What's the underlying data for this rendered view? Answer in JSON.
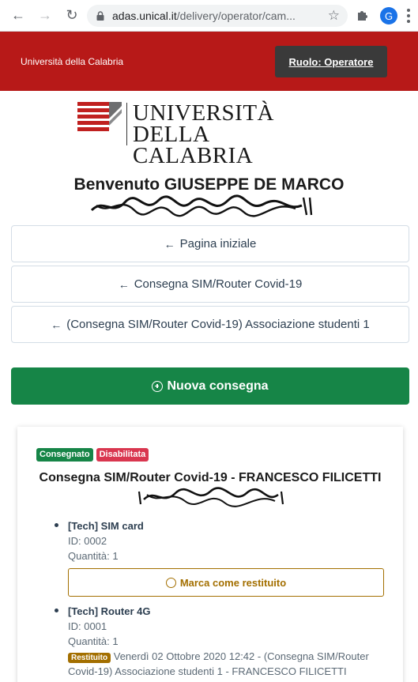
{
  "browser": {
    "url_domain": "adas.unical.it",
    "url_rest": "/delivery/operator/cam...",
    "profile_initial": "G"
  },
  "header": {
    "university_label": "Università della Calabria",
    "role_button": "Ruolo: Operatore"
  },
  "logo": {
    "line1": "UNIVERSITÀ",
    "line2": "DELLA CALABRIA"
  },
  "welcome": {
    "text": "Benvenuto GIUSEPPE DE MARCO"
  },
  "nav": {
    "home": "Pagina iniziale",
    "campaign": "Consegna SIM/Router Covid-19",
    "structure": "(Consegna SIM/Router Covid-19) Associazione studenti 1"
  },
  "new_delivery_button": "Nuova consegna",
  "card": {
    "badge_status": "Consegnato",
    "badge_disabled": "Disabilitata",
    "title": "Consegna SIM/Router Covid-19 - FRANCESCO FILICETTI",
    "items": [
      {
        "name": "[Tech] SIM card",
        "id": "ID: 0002",
        "qty": "Quantità: 1",
        "action": "Marca come restituito"
      },
      {
        "name": "[Tech] Router 4G",
        "id": "ID: 0001",
        "qty": "Quantità: 1",
        "returned_badge": "Restituito",
        "returned_text": "Venerdì 02 Ottobre 2020 12:42 - (Consegna SIM/Router Covid-19) Associazione studenti 1 - FRANCESCO FILICETTI"
      }
    ]
  }
}
